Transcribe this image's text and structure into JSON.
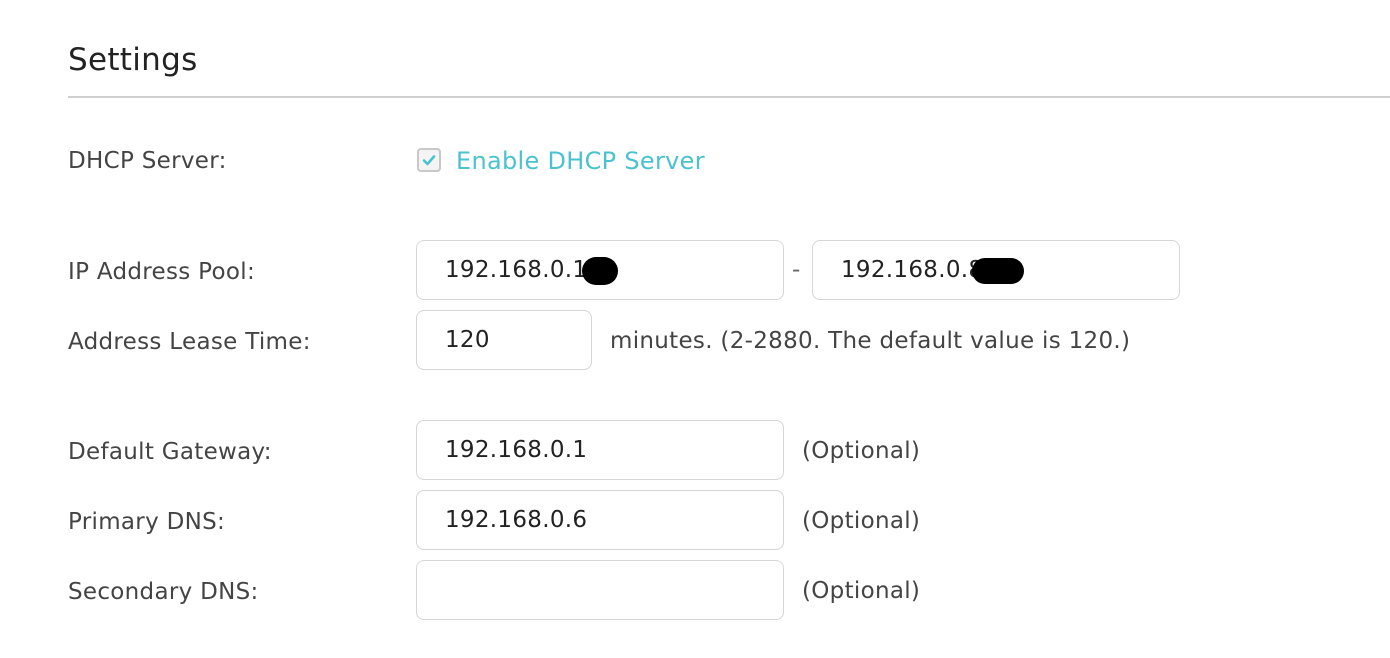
{
  "settings": {
    "title": "Settings"
  },
  "dhcp": {
    "label": "DHCP Server:",
    "enable_label": "Enable DHCP Server",
    "enabled": true
  },
  "ip_pool": {
    "label": "IP Address Pool:",
    "start_value": "192.168.0.1",
    "separator": "-",
    "end_value": "192.168.0.8"
  },
  "lease": {
    "label": "Address Lease Time:",
    "value": "120",
    "hint": "minutes. (2-2880. The default value is 120.)"
  },
  "gateway": {
    "label": "Default Gateway:",
    "value": "192.168.0.1",
    "hint": "(Optional)"
  },
  "primary_dns": {
    "label": "Primary DNS:",
    "value": "192.168.0.6",
    "hint": "(Optional)"
  },
  "secondary_dns": {
    "label": "Secondary DNS:",
    "value": "",
    "hint": "(Optional)"
  },
  "colors": {
    "accent": "#4ac3cf",
    "redaction": "#000000"
  }
}
